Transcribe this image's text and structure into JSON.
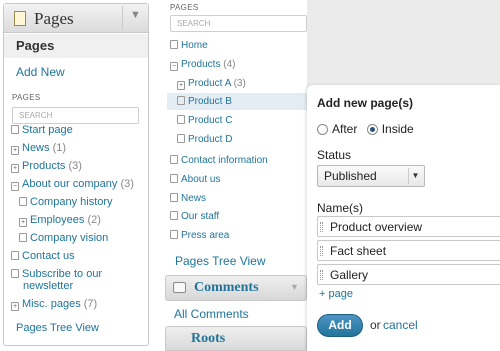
{
  "left": {
    "title": "Pages",
    "collapse_arrow": "▼",
    "active_item": "Pages",
    "add_new": "Add New",
    "section_label": "PAGES",
    "search_placeholder": "SEARCH",
    "tree": [
      {
        "label": "Start page",
        "count": "",
        "icon": "box"
      },
      {
        "label": "News",
        "count": "(1)",
        "icon": "plus"
      },
      {
        "label": "Products",
        "count": "(3)",
        "icon": "plus"
      },
      {
        "label": "About our company",
        "count": "(3)",
        "icon": "minus"
      },
      {
        "label": "Company history",
        "count": "",
        "icon": "box"
      },
      {
        "label": "Employees",
        "count": "(2)",
        "icon": "plus"
      },
      {
        "label": "Company vision",
        "count": "",
        "icon": "box"
      },
      {
        "label": "Contact us",
        "count": "",
        "icon": "box"
      },
      {
        "label": "Subscribe to our",
        "label2": "newsletter",
        "count": "",
        "icon": "box"
      },
      {
        "label": "Misc. pages",
        "count": "(7)",
        "icon": "plus"
      }
    ],
    "tree_view": "Pages Tree View"
  },
  "middle": {
    "section_label": "PAGES",
    "search_placeholder": "SEARCH",
    "tree": [
      {
        "label": "Home",
        "count": "",
        "icon": "box"
      },
      {
        "label": "Products",
        "count": "(4)",
        "icon": "minus"
      },
      {
        "label": "Product A",
        "count": "(3)",
        "icon": "plus"
      },
      {
        "label": "Product B",
        "count": "",
        "icon": "box"
      },
      {
        "label": "Product C",
        "count": "",
        "icon": "box"
      },
      {
        "label": "Product D",
        "count": "",
        "icon": "box"
      },
      {
        "label": "Contact information",
        "count": "",
        "icon": "box"
      },
      {
        "label": "About us",
        "count": "",
        "icon": "box"
      },
      {
        "label": "News",
        "count": "",
        "icon": "box"
      },
      {
        "label": "Our staff",
        "count": "",
        "icon": "box"
      },
      {
        "label": "Press area",
        "count": "",
        "icon": "box"
      }
    ],
    "selected_item": "Product B",
    "tree_view": "Pages Tree View",
    "comments_title": "Comments",
    "comments_arrow": "▼",
    "all_comments": "All Comments",
    "roots_title": "Roots"
  },
  "dialog": {
    "heading": "Add new page(s)",
    "position_after": "After",
    "position_inside": "Inside",
    "selected_position": "Inside",
    "status_label": "Status",
    "status_value": "Published",
    "names_label": "Name(s)",
    "names": [
      "Product overview",
      "Fact sheet",
      "Gallery"
    ],
    "add_page_link": "+ page",
    "add_button": "Add",
    "or_text": "or",
    "cancel_link": "cancel"
  }
}
